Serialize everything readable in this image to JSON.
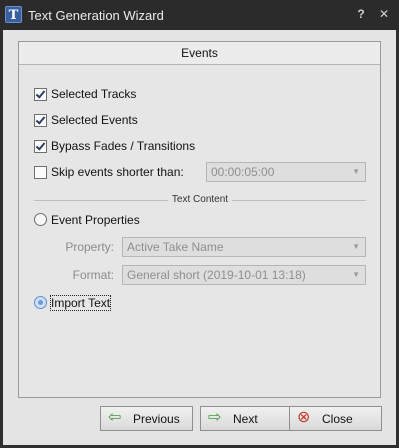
{
  "window": {
    "title": "Text Generation Wizard",
    "app_icon_glyph": "T",
    "help_glyph": "?",
    "close_glyph": "✕"
  },
  "panel": {
    "header": "Events",
    "options": [
      {
        "label": "Selected Tracks",
        "checked": true
      },
      {
        "label": "Selected Events",
        "checked": true
      },
      {
        "label": "Bypass Fades / Transitions",
        "checked": true
      },
      {
        "label": "Skip events shorter than:",
        "checked": false
      }
    ],
    "skip_duration_value": "00:00:05:00",
    "text_content_separator": "Text Content",
    "event_properties": {
      "label": "Event Properties",
      "property_label": "Property:",
      "property_value": "Active Take Name",
      "format_label": "Format:",
      "format_value": "General short (2019-10-01 13:18)"
    },
    "import_text_label": "Import Text"
  },
  "buttons": {
    "previous": "Previous",
    "next": "Next",
    "close": "Close"
  },
  "colors": {
    "titlebar": "#2b2b2b",
    "client_bg": "#e4e4e4",
    "arrow_green": "#3d9a37",
    "close_red": "#c33b2a"
  },
  "icons": {
    "app": "text-generation-app-icon",
    "help": "help-icon",
    "close": "close-icon",
    "previous": "arrow-left-icon",
    "next": "arrow-right-icon",
    "close_button": "close-circle-icon"
  }
}
